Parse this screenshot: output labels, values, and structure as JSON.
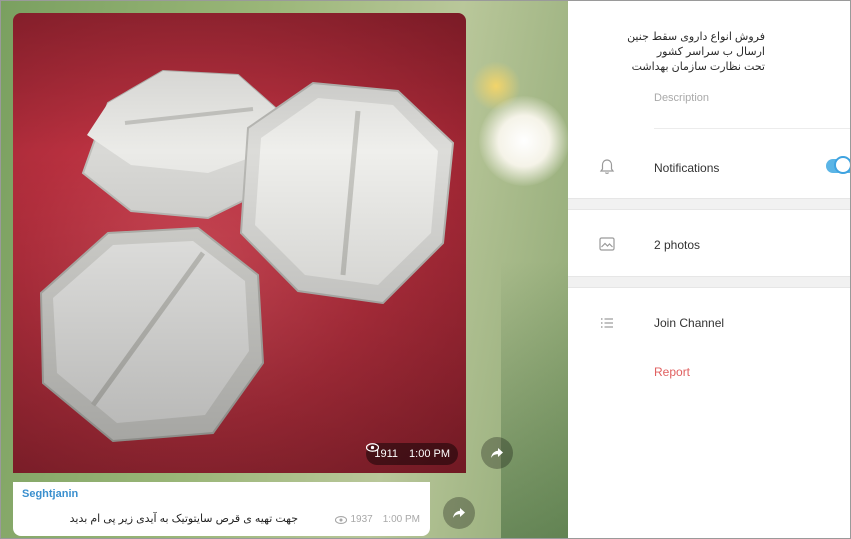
{
  "chat": {
    "photo_message": {
      "views": "1911",
      "time": "1:00 PM"
    },
    "text_message": {
      "author": "Seghtjanin",
      "text": "جهت تهیه ی قرص سایتوتیک به آیدی زیر پی ام بدید",
      "views": "1937",
      "time": "1:00 PM"
    }
  },
  "panel": {
    "description_lines": [
      "فروش انواع داروی سقط جنین",
      "ارسال ب سراسر کشور",
      "تحت نظارت سازمان بهداشت"
    ],
    "description_label": "Description",
    "notifications_label": "Notifications",
    "notifications_enabled": true,
    "photos_label": "2 photos",
    "join_label": "Join Channel",
    "report_label": "Report"
  },
  "colors": {
    "accent": "#5bb5e6",
    "author": "#3a8fce",
    "report": "#e06060"
  },
  "icons": {
    "views": "eye-icon",
    "share": "share-arrow-icon",
    "notifications": "bell-icon",
    "photos": "photo-icon",
    "join": "list-icon"
  }
}
